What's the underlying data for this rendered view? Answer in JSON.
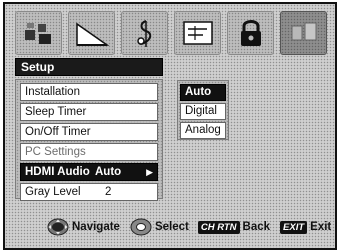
{
  "icons": [
    {
      "name": "picture-icon",
      "active": false
    },
    {
      "name": "sound-icon",
      "active": false
    },
    {
      "name": "music-icon",
      "active": false
    },
    {
      "name": "guide-icon",
      "active": false
    },
    {
      "name": "lock-icon",
      "active": false
    },
    {
      "name": "setup-icon",
      "active": true
    }
  ],
  "menu": {
    "title": "Setup",
    "items": [
      {
        "label": "Installation",
        "value": ""
      },
      {
        "label": "Sleep Timer",
        "value": ""
      },
      {
        "label": "On/Off Timer",
        "value": ""
      },
      {
        "label": "PC Settings",
        "value": ""
      },
      {
        "label": "HDMI Audio",
        "value": "Auto"
      },
      {
        "label": "Gray Level",
        "value": "2"
      }
    ]
  },
  "submenu": {
    "items": [
      "Auto",
      "Digital",
      "Analog"
    ]
  },
  "help": {
    "navigate": "Navigate",
    "select": "Select",
    "ch_rtn_key": "CH RTN",
    "back": "Back",
    "exit_key": "EXIT",
    "exit": "Exit"
  }
}
